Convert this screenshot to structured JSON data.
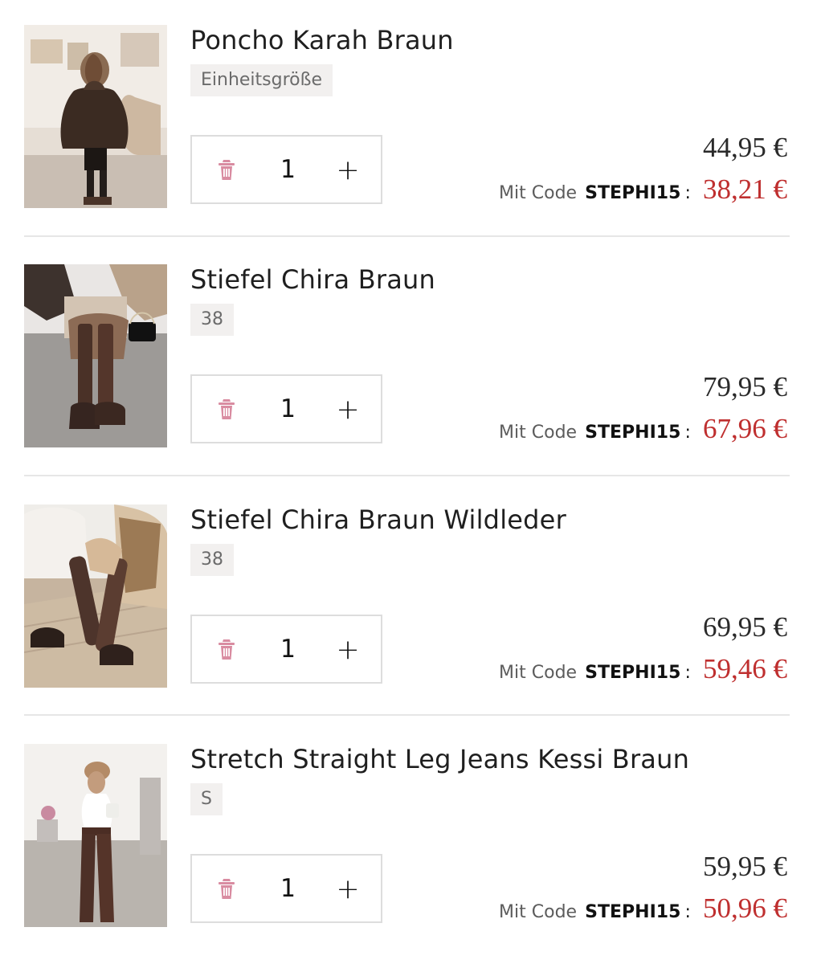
{
  "cart": {
    "items": [
      {
        "title": "Poncho Karah Braun",
        "variant": "Einheitsgröße",
        "quantity": "1",
        "price": "44,95 €",
        "discount_label": "Mit Code",
        "discount_code": "STEPHI15",
        "discount_suffix": ":",
        "discount_price": "38,21 €",
        "image_alt": "Poncho Karah Braun"
      },
      {
        "title": "Stiefel Chira Braun",
        "variant": "38",
        "quantity": "1",
        "price": "79,95 €",
        "discount_label": "Mit Code",
        "discount_code": "STEPHI15",
        "discount_suffix": ":",
        "discount_price": "67,96 €",
        "image_alt": "Stiefel Chira Braun"
      },
      {
        "title": "Stiefel Chira Braun Wildleder",
        "variant": "38",
        "quantity": "1",
        "price": "69,95 €",
        "discount_label": "Mit Code",
        "discount_code": "STEPHI15",
        "discount_suffix": ":",
        "discount_price": "59,46 €",
        "image_alt": "Stiefel Chira Braun Wildleder"
      },
      {
        "title": "Stretch Straight Leg Jeans Kessi Braun",
        "variant": "S",
        "quantity": "1",
        "price": "59,95 €",
        "discount_label": "Mit Code",
        "discount_code": "STEPHI15",
        "discount_suffix": ":",
        "discount_price": "50,96 €",
        "image_alt": "Stretch Straight Leg Jeans Kessi Braun"
      }
    ],
    "icons": {
      "remove": "trash-icon",
      "increase": "plus-icon"
    },
    "colors": {
      "discount_price": "#bf2f2f",
      "trash_icon": "#d98ca1",
      "divider": "#e6e6e6",
      "variant_bg": "#f2f0ef"
    }
  }
}
